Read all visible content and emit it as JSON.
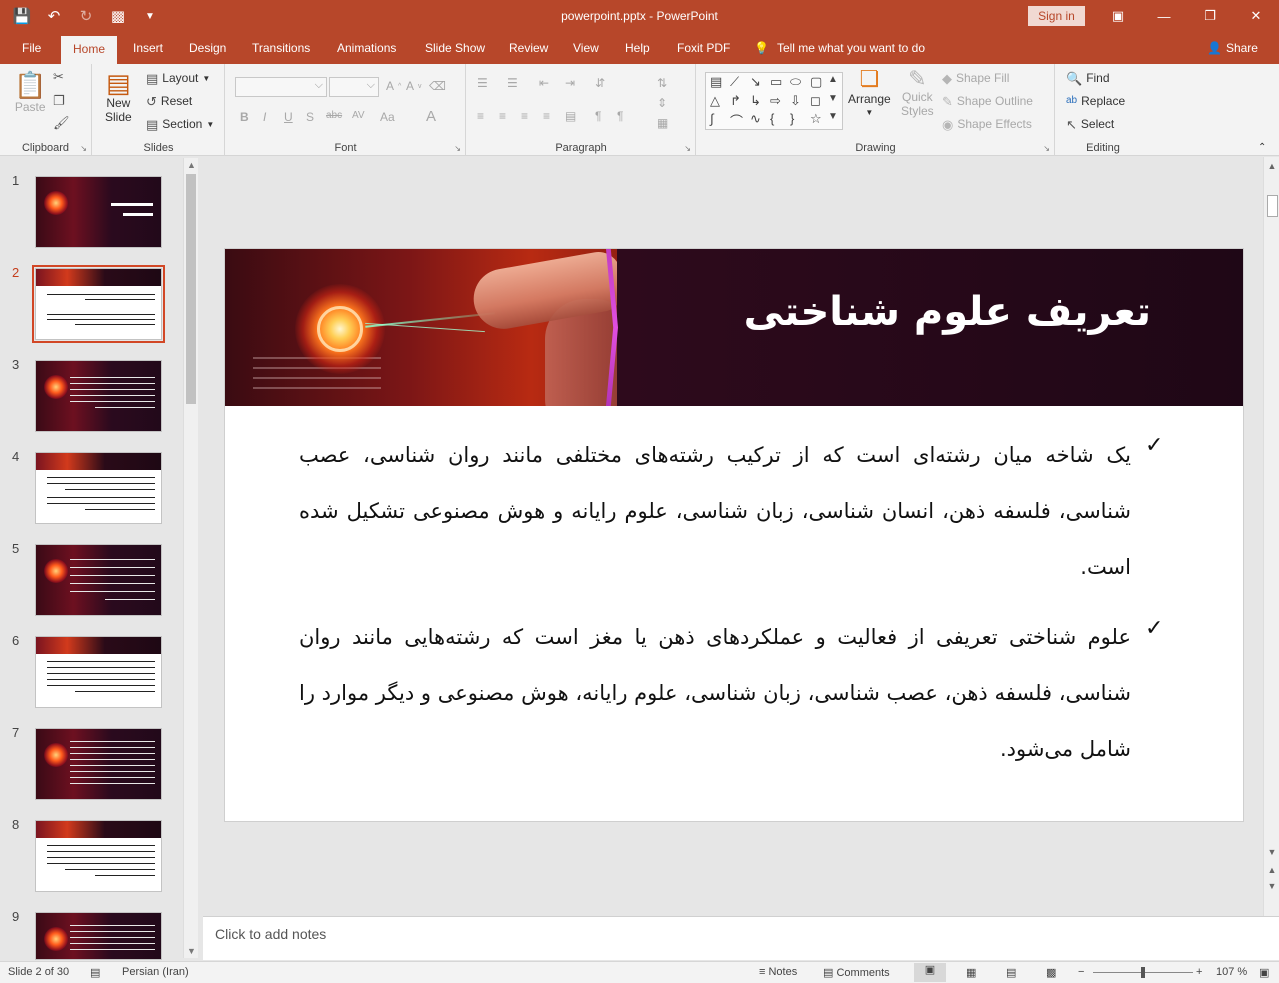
{
  "app": {
    "doc_title": "powerpoint.pptx  -  PowerPoint",
    "signin": "Sign in",
    "tabs": [
      "File",
      "Home",
      "Insert",
      "Design",
      "Transitions",
      "Animations",
      "Slide Show",
      "Review",
      "View",
      "Help",
      "Foxit PDF"
    ],
    "active_tab": "Home",
    "tellme": "Tell me what you want to do",
    "share": "Share"
  },
  "ribbon": {
    "clipboard": {
      "label": "Clipboard",
      "paste": "Paste"
    },
    "slides": {
      "label": "Slides",
      "new_slide_1": "New",
      "new_slide_2": "Slide",
      "layout": "Layout",
      "reset": "Reset",
      "section": "Section"
    },
    "font": {
      "label": "Font"
    },
    "paragraph": {
      "label": "Paragraph"
    },
    "drawing": {
      "label": "Drawing",
      "arrange": "Arrange",
      "quick_styles_1": "Quick",
      "quick_styles_2": "Styles",
      "shape_fill": "Shape Fill",
      "shape_outline": "Shape Outline",
      "shape_effects": "Shape Effects"
    },
    "editing": {
      "label": "Editing",
      "find": "Find",
      "replace": "Replace",
      "select": "Select"
    }
  },
  "thumbnails": [
    "1",
    "2",
    "3",
    "4",
    "5",
    "6",
    "7",
    "8",
    "9"
  ],
  "selected_slide": "2",
  "slide": {
    "title": "تعریف علوم شناختی",
    "paragraph1": "یک شاخه میان رشته‌ای است که از ترکیب رشته‌های مختلفی مانند روان شناسی، عصب شناسی، فلسفه ذهن، انسان شناسی، زبان شناسی، علوم رایانه و هوش مصنوعی تشکیل شده است.",
    "paragraph2": "علوم شناختی تعریفی از فعالیت و عملکردهای ذهن یا مغز است که رشته‌هایی مانند روان شناسی، فلسفه ذهن، عصب شناسی، زبان شناسی، علوم رایانه، هوش مصنوعی و دیگر موارد را شامل می‌شود."
  },
  "notes_placeholder": "Click to add notes",
  "status": {
    "slide_of": "Slide 2 of 30",
    "language": "Persian (Iran)",
    "notes": "Notes",
    "comments": "Comments",
    "zoom": "107 %"
  },
  "colors": {
    "accent": "#b7472a",
    "banner_divider": "#c13cc4"
  }
}
